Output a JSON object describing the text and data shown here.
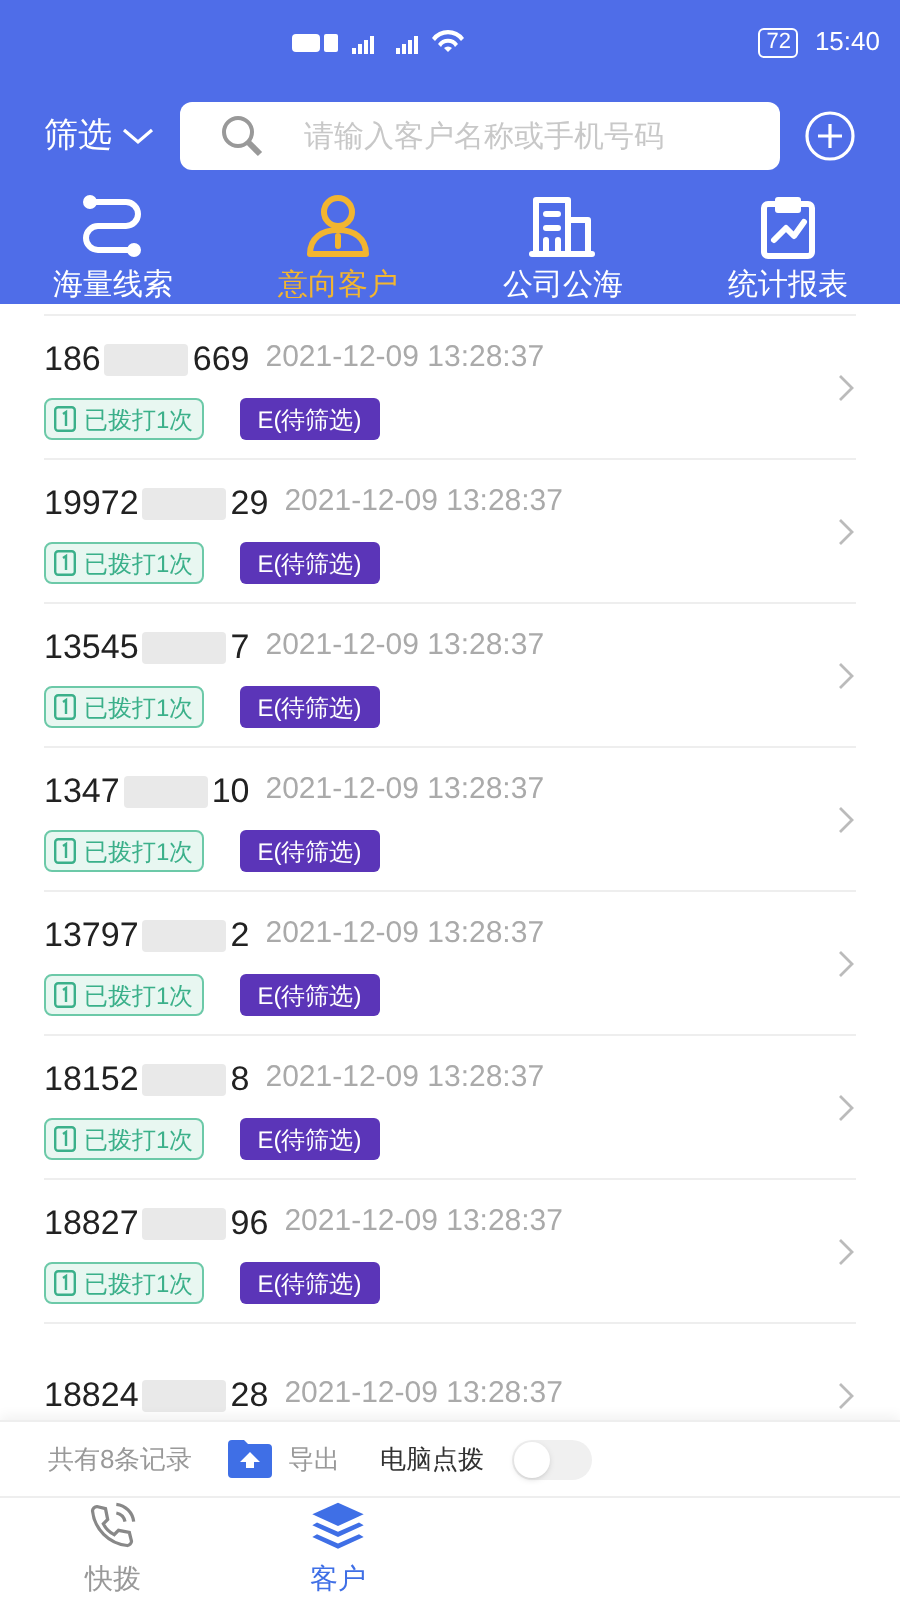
{
  "status_bar": {
    "battery": "72",
    "time": "15:40"
  },
  "search": {
    "filter": "筛选",
    "placeholder": "请输入客户名称或手机号码"
  },
  "tabs": [
    {
      "label": "海量线索",
      "selected": false
    },
    {
      "label": "意向客户",
      "selected": true
    },
    {
      "label": "公司公海",
      "selected": false
    },
    {
      "label": "统计报表",
      "selected": false
    }
  ],
  "rows": [
    {
      "phone_start": "186",
      "phone_end": "669",
      "time": "2021-12-09 13:28:37",
      "call_tag": "已拨打1次",
      "level_tag": "E(待筛选)"
    },
    {
      "phone_start": "19972",
      "phone_end": "29",
      "time": "2021-12-09 13:28:37",
      "call_tag": "已拨打1次",
      "level_tag": "E(待筛选)"
    },
    {
      "phone_start": "13545",
      "phone_end": "7",
      "time": "2021-12-09 13:28:37",
      "call_tag": "已拨打1次",
      "level_tag": "E(待筛选)"
    },
    {
      "phone_start": "1347",
      "phone_end": "10",
      "time": "2021-12-09 13:28:37",
      "call_tag": "已拨打1次",
      "level_tag": "E(待筛选)"
    },
    {
      "phone_start": "13797",
      "phone_end": "2",
      "time": "2021-12-09 13:28:37",
      "call_tag": "已拨打1次",
      "level_tag": "E(待筛选)"
    },
    {
      "phone_start": "18152",
      "phone_end": "8",
      "time": "2021-12-09 13:28:37",
      "call_tag": "已拨打1次",
      "level_tag": "E(待筛选)"
    },
    {
      "phone_start": "18827",
      "phone_end": "96",
      "time": "2021-12-09 13:28:37",
      "call_tag": "已拨打1次",
      "level_tag": "E(待筛选)"
    },
    {
      "phone_start": "18824",
      "phone_end": "28",
      "time": "2021-12-09 13:28:37"
    }
  ],
  "footer": {
    "count": "共有8条记录",
    "export": "导出",
    "pc_dial": "电脑点拨",
    "pc_dial_on": false
  },
  "bottom_nav": [
    {
      "label": "快拨",
      "selected": false
    },
    {
      "label": "客户",
      "selected": true
    }
  ]
}
